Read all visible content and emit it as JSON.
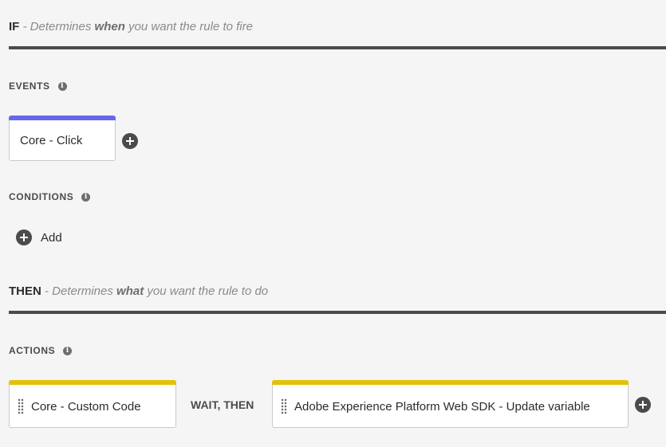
{
  "if_section": {
    "keyword": "IF",
    "desc_prefix": " - Determines ",
    "desc_strong": "when",
    "desc_suffix": " you want the rule to fire"
  },
  "events": {
    "label": "EVENTS",
    "info_icon": "info-icon",
    "items": [
      {
        "label": "Core - Click",
        "accent": "#6767ec"
      }
    ]
  },
  "conditions": {
    "label": "CONDITIONS",
    "info_icon": "info-icon",
    "add_label": "Add"
  },
  "then_section": {
    "keyword": "THEN",
    "desc_prefix": " - Determines ",
    "desc_strong": "what",
    "desc_suffix": " you want the rule to do"
  },
  "actions": {
    "label": "ACTIONS",
    "info_icon": "info-icon",
    "items": [
      {
        "label": "Core - Custom Code",
        "accent": "#e2c208"
      },
      {
        "label": "Adobe Experience Platform Web SDK - Update variable",
        "accent": "#e2c208"
      }
    ],
    "separator": "WAIT, THEN"
  }
}
